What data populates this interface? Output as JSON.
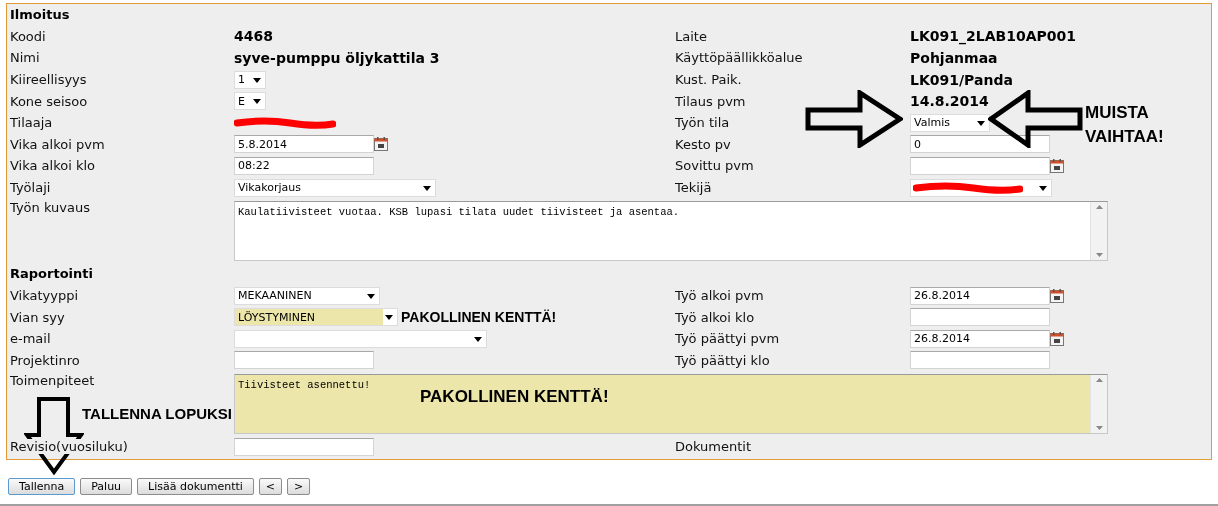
{
  "sections": [
    {
      "title": "Ilmoitus",
      "rows": [
        {
          "left": {
            "label": "Koodi",
            "field": {
              "kind": "value",
              "value": "4468"
            }
          },
          "right": {
            "label": "Laite",
            "field": {
              "kind": "value",
              "value": "LK091_2LAB10AP001"
            }
          }
        },
        {
          "left": {
            "label": "Nimi",
            "field": {
              "kind": "value",
              "value": "syve-pumppu öljykattila 3"
            }
          },
          "right": {
            "label": "Käyttöpäällikköalue",
            "field": {
              "kind": "value",
              "value": "Pohjanmaa"
            }
          }
        },
        {
          "left": {
            "label": "Kiireellisyys",
            "field": {
              "kind": "select",
              "value": "1"
            }
          },
          "right": {
            "label": "Kust. Paik.",
            "field": {
              "kind": "value",
              "value": "LK091/Panda"
            }
          }
        },
        {
          "left": {
            "label": "Kone seisoo",
            "field": {
              "kind": "select",
              "value": "E"
            }
          },
          "right": {
            "label": "Tilaus pvm",
            "field": {
              "kind": "value",
              "value": "14.8.2014"
            }
          }
        },
        {
          "left": {
            "label": "Tilaaja",
            "field": {
              "kind": "redacted"
            }
          },
          "right": {
            "label": "Työn tila",
            "field": {
              "kind": "select",
              "value": "Valmis"
            }
          }
        },
        {
          "left": {
            "label": "Vika alkoi pvm",
            "field": {
              "kind": "date",
              "value": "5.8.2014"
            }
          },
          "right": {
            "label": "Kesto pv",
            "field": {
              "kind": "input",
              "value": "0"
            }
          }
        },
        {
          "left": {
            "label": "Vika alkoi klo",
            "field": {
              "kind": "input",
              "value": "08:22"
            }
          },
          "right": {
            "label": "Sovittu pvm",
            "field": {
              "kind": "date"
            }
          }
        },
        {
          "left": {
            "label": "Työlaji",
            "field": {
              "kind": "select",
              "value": "Vikakorjaus"
            }
          },
          "right": {
            "label": "Tekijä",
            "field": {
              "kind": "select",
              "redacted": true
            }
          }
        },
        {
          "wide": {
            "label": "Työn kuvaus",
            "field": {
              "kind": "textarea",
              "value": "Kaulatiivisteet vuotaa. KSB lupasi tilata uudet tiivisteet ja asentaa.",
              "required": false
            }
          }
        }
      ]
    },
    {
      "title": "Raportointi",
      "rows": [
        {
          "left": {
            "label": "Vikatyyppi",
            "field": {
              "kind": "select",
              "value": "MEKAANINEN"
            }
          },
          "right": {
            "label": "Työ alkoi pvm",
            "field": {
              "kind": "date",
              "value": "26.8.2014"
            }
          }
        },
        {
          "left": {
            "label": "Vian syy",
            "field": {
              "kind": "select",
              "value": "LÖYSTYMINEN",
              "required": true,
              "note": "PAKOLLINEN KENTTÄ!"
            }
          },
          "right": {
            "label": "Työ alkoi klo",
            "field": {
              "kind": "input"
            }
          }
        },
        {
          "left": {
            "label": "e-mail",
            "field": {
              "kind": "select"
            }
          },
          "right": {
            "label": "Työ päättyi pvm",
            "field": {
              "kind": "date",
              "value": "26.8.2014"
            }
          }
        },
        {
          "left": {
            "label": "Projektinro",
            "field": {
              "kind": "input"
            }
          },
          "right": {
            "label": "Työ päättyi klo",
            "field": {
              "kind": "input"
            }
          }
        },
        {
          "wide": {
            "label": "Toimenpiteet",
            "field": {
              "kind": "textarea",
              "value": "Tiivisteet asennettu!",
              "required": true
            }
          }
        },
        {
          "left": {
            "label": "Revisio(vuosiluku)",
            "field": {
              "kind": "input"
            }
          },
          "right": {
            "label": "Dokumentit"
          }
        }
      ]
    }
  ],
  "annotations": [
    {
      "kind": "double-arrow",
      "text": "MUISTA VAIHTAA!"
    },
    {
      "kind": "overlay",
      "text": "PAKOLLINEN KENTTÄ!"
    },
    {
      "kind": "down-arrow",
      "text": "TALLENNA LOPUKSI"
    }
  ],
  "buttons": [
    {
      "label": "Tallenna",
      "default": true
    },
    {
      "label": "Paluu",
      "default": false
    },
    {
      "label": "Lisää dokumentti",
      "default": false
    },
    {
      "label": "<",
      "default": false
    },
    {
      "label": ">",
      "default": false
    }
  ]
}
